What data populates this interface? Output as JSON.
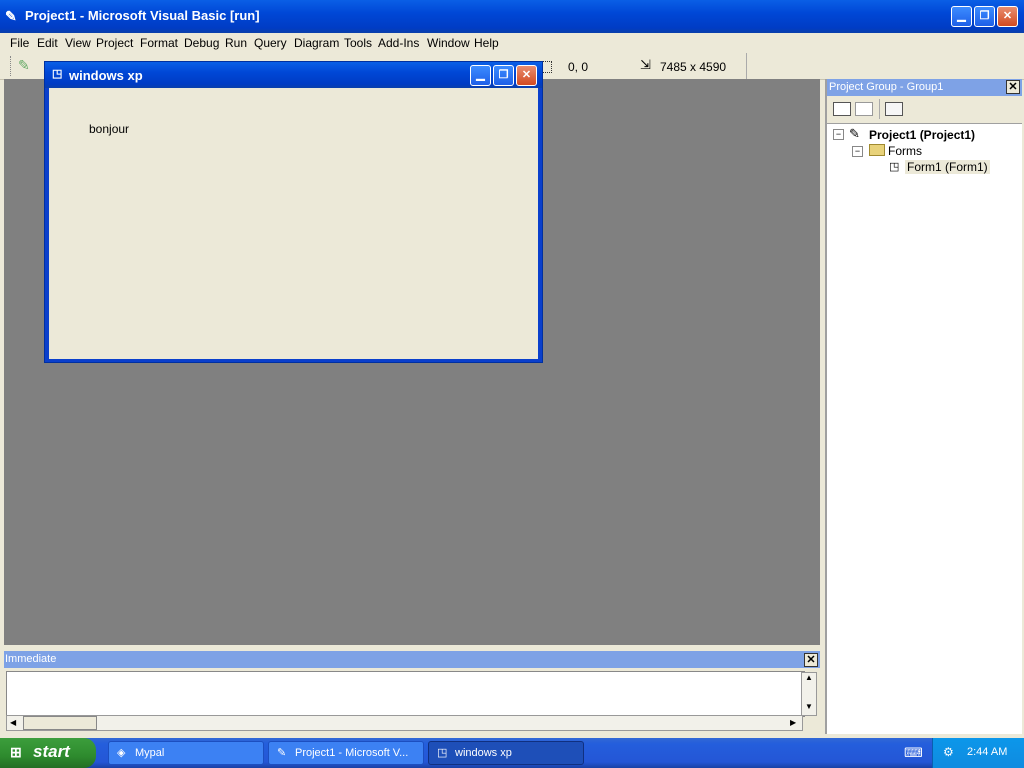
{
  "main_window": {
    "title": "Project1 - Microsoft Visual Basic [run]",
    "menu": [
      "File",
      "Edit",
      "View",
      "Project",
      "Format",
      "Debug",
      "Run",
      "Query",
      "Diagram",
      "Tools",
      "Add-Ins",
      "Window",
      "Help"
    ],
    "coords": "0, 0",
    "size": "7485 x 4590"
  },
  "form_window": {
    "title": "windows xp",
    "label_text": "bonjour"
  },
  "project_panel": {
    "title": "Project Group - Group1",
    "tree": {
      "project": "Project1 (Project1)",
      "folder": "Forms",
      "form": "Form1 (Form1)"
    }
  },
  "immediate": {
    "title": "Immediate"
  },
  "taskbar": {
    "start_label": "start",
    "tasks": [
      {
        "label": "Mypal"
      },
      {
        "label": "Project1 - Microsoft V..."
      },
      {
        "label": "windows xp"
      }
    ],
    "clock": "2:44 AM"
  }
}
